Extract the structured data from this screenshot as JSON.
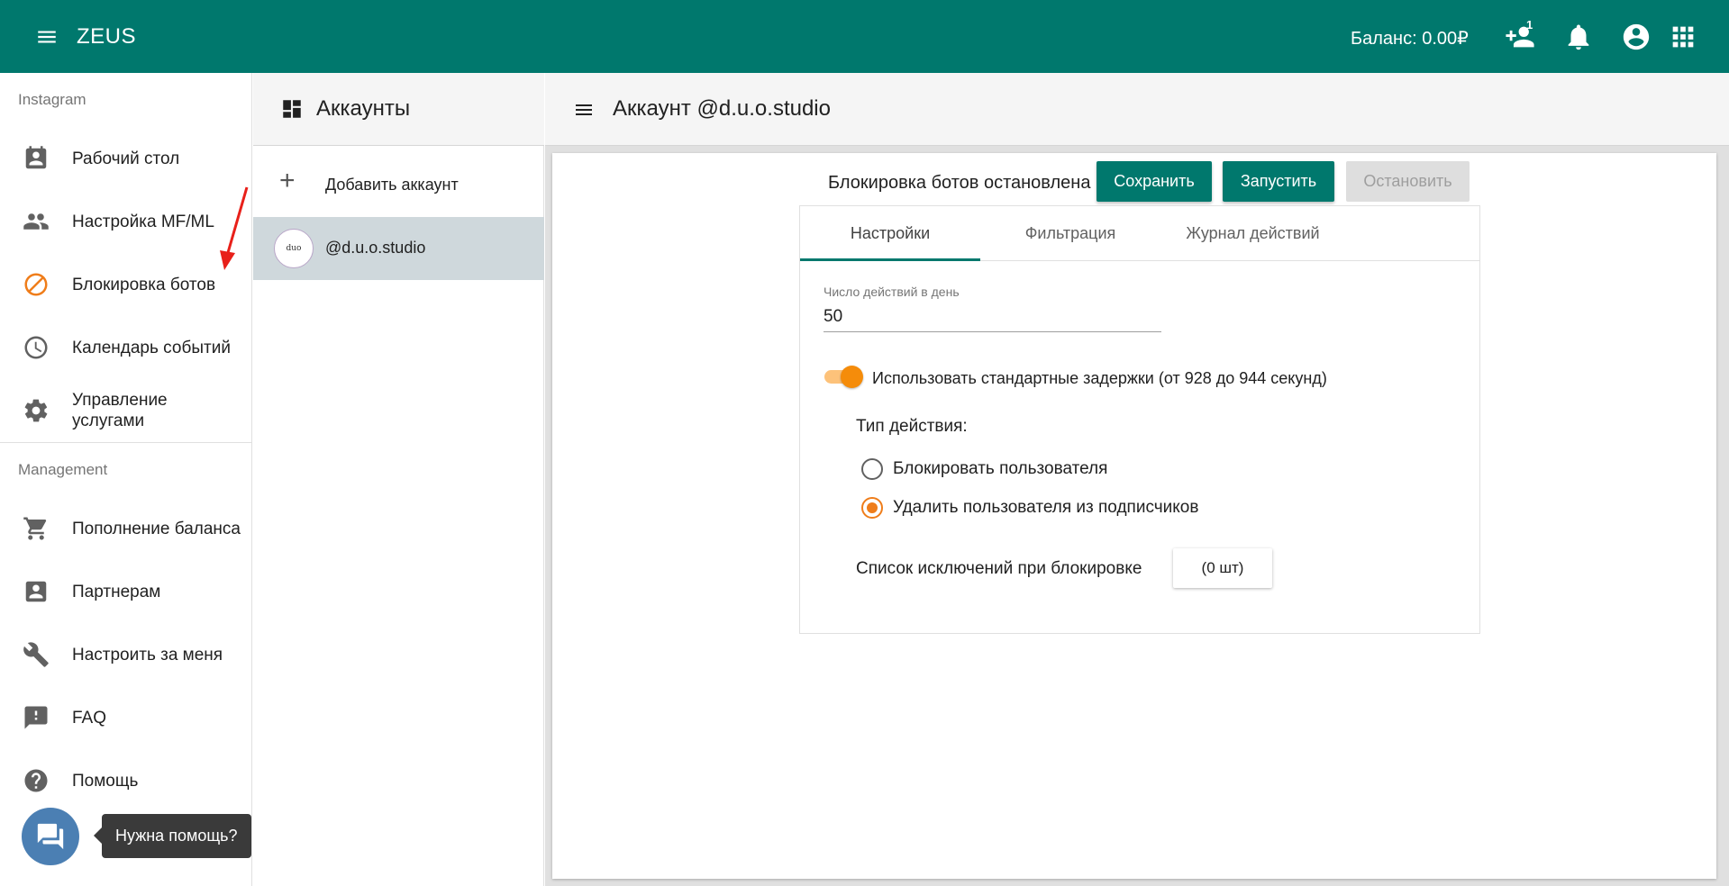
{
  "app": {
    "title": "ZEUS",
    "balance": "Баланс: 0.00₽",
    "friend_requests_count": "1"
  },
  "colors": {
    "primary": "#00786d",
    "accent": "#ef7d1a"
  },
  "sidebar": {
    "sections": [
      {
        "title": "Instagram"
      },
      {
        "title": "Management"
      }
    ],
    "items": [
      {
        "label": "Рабочий стол",
        "icon": "contact-card-icon"
      },
      {
        "label": "Настройка MF/ML",
        "icon": "people-icon"
      },
      {
        "label": "Блокировка ботов",
        "icon": "block-icon",
        "active": true
      },
      {
        "label": "Календарь событий",
        "icon": "clock-icon"
      },
      {
        "label": "Управление услугами",
        "icon": "gear-icon"
      },
      {
        "label": "Пополнение баланса",
        "icon": "cart-icon"
      },
      {
        "label": "Партнерам",
        "icon": "account-box-icon"
      },
      {
        "label": "Настроить за меня",
        "icon": "wrench-icon"
      },
      {
        "label": "FAQ",
        "icon": "feedback-icon"
      },
      {
        "label": "Помощь",
        "icon": "help-icon"
      }
    ],
    "help_tooltip": "Нужна помощь?"
  },
  "accounts": {
    "title": "Аккаунты",
    "add_label": "Добавить аккаунт",
    "list": [
      {
        "handle": "@d.u.o.studio"
      }
    ]
  },
  "main": {
    "title": "Аккаунт @d.u.o.studio",
    "status": "Блокировка ботов остановлена",
    "buttons": {
      "save": "Сохранить",
      "start": "Запустить",
      "stop": "Остановить"
    },
    "tabs": [
      {
        "label": "Настройки",
        "active": true
      },
      {
        "label": "Фильтрация"
      },
      {
        "label": "Журнал действий"
      }
    ],
    "actions_per_day": {
      "label": "Число действий в день",
      "value": "50"
    },
    "default_delays": {
      "label": "Использовать стандартные задержки (от 928 до 944 секунд)",
      "enabled": true
    },
    "action_type": {
      "label": "Тип действия:",
      "options": [
        {
          "label": "Блокировать пользователя",
          "selected": false
        },
        {
          "label": "Удалить пользователя из подписчиков",
          "selected": true
        }
      ]
    },
    "exclusions": {
      "label": "Список исключений при блокировке",
      "button": "(0 шт)"
    }
  }
}
